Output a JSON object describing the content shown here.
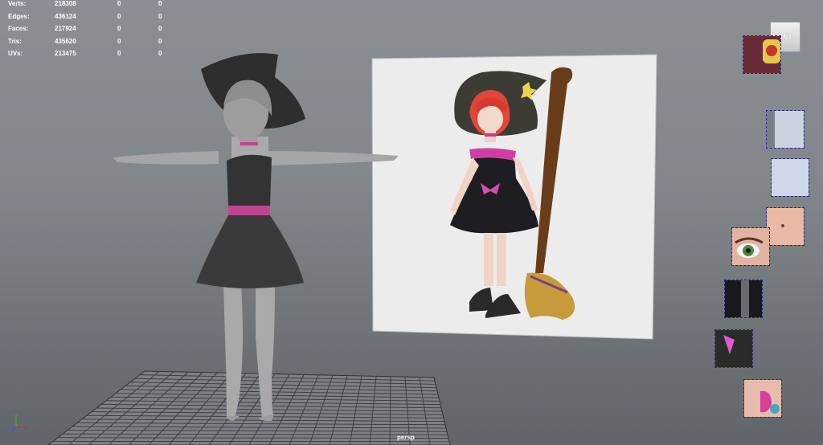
{
  "hud": {
    "rows": [
      {
        "label": "Verts:",
        "v1": "218308",
        "v2": "0",
        "v3": "0"
      },
      {
        "label": "Edges:",
        "v1": "436124",
        "v2": "0",
        "v3": "0"
      },
      {
        "label": "Faces:",
        "v1": "217924",
        "v2": "0",
        "v3": "0"
      },
      {
        "label": "Tris:",
        "v1": "435620",
        "v2": "0",
        "v3": "0"
      },
      {
        "label": "UVs:",
        "v1": "213475",
        "v2": "0",
        "v3": "0"
      }
    ]
  },
  "viewcube": {
    "label": "FRONT",
    "visible_text": "ONT"
  },
  "camera": {
    "label": "persp"
  },
  "colors": {
    "viewport_top": "#8a8f94",
    "viewport_bottom": "#60656a",
    "model_gray": "#9a9a9a",
    "dress_dark": "#3a3a3a",
    "belt_pink": "#c0458f",
    "selection_dash": "#2a2a8a"
  },
  "icons": {
    "axis": "axis-gizmo-icon",
    "viewcube": "view-cube-icon"
  }
}
